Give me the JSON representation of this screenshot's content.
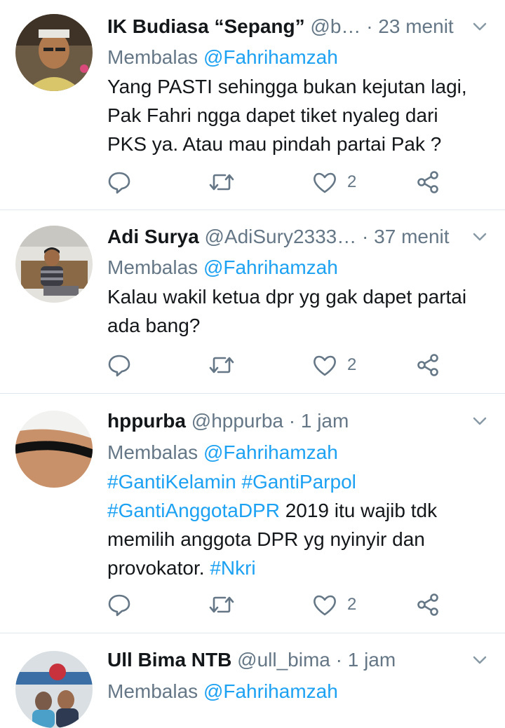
{
  "tweets": [
    {
      "name": "IK Budiasa “Sepang”",
      "handle": "@b…",
      "dot": "·",
      "time": "23 menit",
      "reply_prefix": "Membalas",
      "reply_to": "@Fahrihamzah",
      "lines": [
        "Yang PASTI sehingga bukan kejutan lagi,",
        "Pak Fahri ngga dapet tiket nyaleg dari",
        "PKS ya. Atau mau pindah partai Pak ?"
      ],
      "like_count": "2"
    },
    {
      "name": "Adi Surya",
      "handle": "@AdiSury2333…",
      "dot": "·",
      "time": "37 menit",
      "reply_prefix": "Membalas",
      "reply_to": "@Fahrihamzah",
      "lines": [
        "Kalau wakil ketua dpr yg gak dapet partai",
        "ada bang?"
      ],
      "like_count": "2"
    },
    {
      "name": "hppurba",
      "handle": "@hppurba",
      "dot": "·",
      "time": "1 jam",
      "reply_prefix": "Membalas",
      "reply_to": "@Fahrihamzah",
      "line1_tag1": "#GantiKelamin",
      "line1_tag2": "#GantiParpol",
      "line2_tag": "#GantiAnggotaDPR",
      "line2_text": "2019 itu wajib tdk",
      "line3": "memilih anggota DPR yg nyinyir dan",
      "line4_text": "provokator.",
      "line4_tag": "#Nkri",
      "like_count": "2"
    },
    {
      "name": "Ull Bima NTB",
      "handle": "@ull_bima",
      "dot": "·",
      "time": "1 jam",
      "reply_prefix": "Membalas",
      "reply_to": "@Fahrihamzah"
    }
  ],
  "icons": {
    "reply": "reply-icon",
    "retweet": "retweet-icon",
    "like": "heart-icon",
    "share": "share-icon",
    "more": "chevron-down-icon"
  },
  "colors": {
    "link": "#1da1f2",
    "muted": "#657786",
    "text": "#14171a",
    "divider": "#e1e8ed"
  }
}
